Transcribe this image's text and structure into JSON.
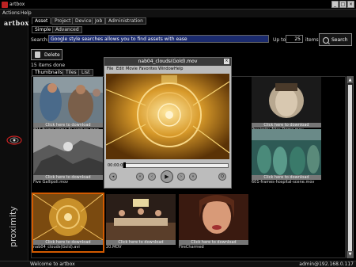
{
  "window": {
    "title": "artbox",
    "minimize": "_",
    "maximize": "□",
    "close": "×"
  },
  "menu": {
    "actions": "Actions",
    "help": "Help"
  },
  "logo": "artbox",
  "brand_vertical": "proximity",
  "tabs": [
    "Asset",
    "Project",
    "Device",
    "Job",
    "Administration"
  ],
  "subtabs": [
    "Simple",
    "Advanced"
  ],
  "search": {
    "label": "Search:",
    "value": "Google style searches allows you to find assets with ease",
    "upto_label": "Up to",
    "upto_value": "25",
    "items_label": "items",
    "button": "Search"
  },
  "delete_button": "Delete",
  "found_text": "15 items done",
  "view_tabs": [
    "Thumbnails",
    "Tiles",
    "List"
  ],
  "download_label": "Click here to download",
  "thumbnails": [
    {
      "caption": "894-frame-prime-fx-capture.mpg"
    },
    {
      "caption": "Proximity Alias Demo.mov"
    },
    {
      "caption": "Five Gallipoli.mov"
    },
    {
      "caption": "601-frames-hospital-scene.mov"
    },
    {
      "caption": "nab04_clouds(Gold).avi"
    },
    {
      "caption": "20.MOV"
    },
    {
      "caption": "FireCharmed"
    }
  ],
  "player": {
    "title": "nab04_clouds(Gold).mov",
    "menu": [
      "File",
      "Edit",
      "Movie",
      "Favorites",
      "Window",
      "Help"
    ],
    "timecode": "00:00:00",
    "progress": 0
  },
  "status": {
    "left": "Welcome to artbox",
    "right": "admin@192.168.0.117"
  },
  "colors": {
    "accent": "#d25a00",
    "search_bg": "#1b2b6e"
  }
}
